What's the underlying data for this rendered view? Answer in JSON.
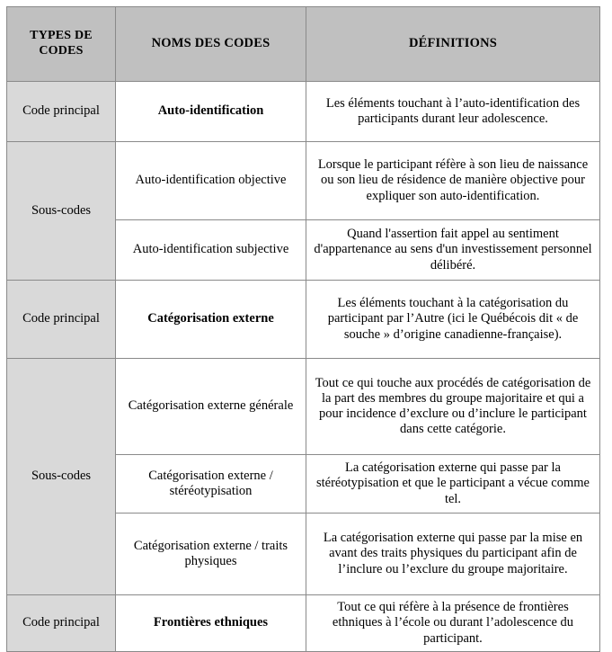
{
  "table": {
    "columns": [
      {
        "key": "types",
        "header": "TYPES DE CODES"
      },
      {
        "key": "noms",
        "header": "NOMS DES CODES"
      },
      {
        "key": "definitions",
        "header": "DÉFINITIONS"
      }
    ],
    "header_background": "#c0c0c0",
    "type_cell_background": "#d9d9d9",
    "border_color": "#8a8a8a",
    "rows": [
      {
        "type": "Code principal",
        "type_rowspan": 1,
        "name": "Auto-identification",
        "name_bold": true,
        "definition": "Les éléments touchant à l’auto-identification des participants durant leur adolescence."
      },
      {
        "type": "Sous-codes",
        "type_rowspan": 2,
        "name": "Auto-identification objective",
        "name_bold": false,
        "definition": "Lorsque le participant réfère à son lieu de naissance ou son lieu de résidence de manière objective pour expliquer son auto-identification."
      },
      {
        "type": "",
        "type_rowspan": 0,
        "name": "Auto-identification subjective",
        "name_bold": false,
        "definition": "Quand l'assertion fait appel au sentiment d'appartenance au sens d'un investissement personnel délibéré."
      },
      {
        "type": "Code principal",
        "type_rowspan": 1,
        "name": "Catégorisation externe",
        "name_bold": true,
        "definition": "Les éléments touchant à la catégorisation du participant par l’Autre (ici le Québécois dit « de souche » d’origine canadienne-française)."
      },
      {
        "type": "Sous-codes",
        "type_rowspan": 3,
        "name": "Catégorisation externe générale",
        "name_bold": false,
        "definition": "Tout ce qui touche aux procédés de catégorisation de la part des membres du groupe majoritaire et qui a pour incidence d’exclure ou d’inclure le participant dans cette catégorie."
      },
      {
        "type": "",
        "type_rowspan": 0,
        "name": "Catégorisation externe / stéréotypisation",
        "name_bold": false,
        "definition": "La catégorisation externe qui passe par la stéréotypisation et que le participant a vécue comme tel."
      },
      {
        "type": "",
        "type_rowspan": 0,
        "name": "Catégorisation externe / traits physiques",
        "name_bold": false,
        "definition": "La catégorisation externe qui passe par la mise en avant des traits physiques du participant afin de l’inclure ou l’exclure du groupe majoritaire."
      },
      {
        "type": "Code principal",
        "type_rowspan": 1,
        "name": "Frontières ethniques",
        "name_bold": true,
        "definition": "Tout ce qui réfère à la présence de frontières ethniques à l’école ou durant l’adolescence du participant."
      }
    ]
  }
}
